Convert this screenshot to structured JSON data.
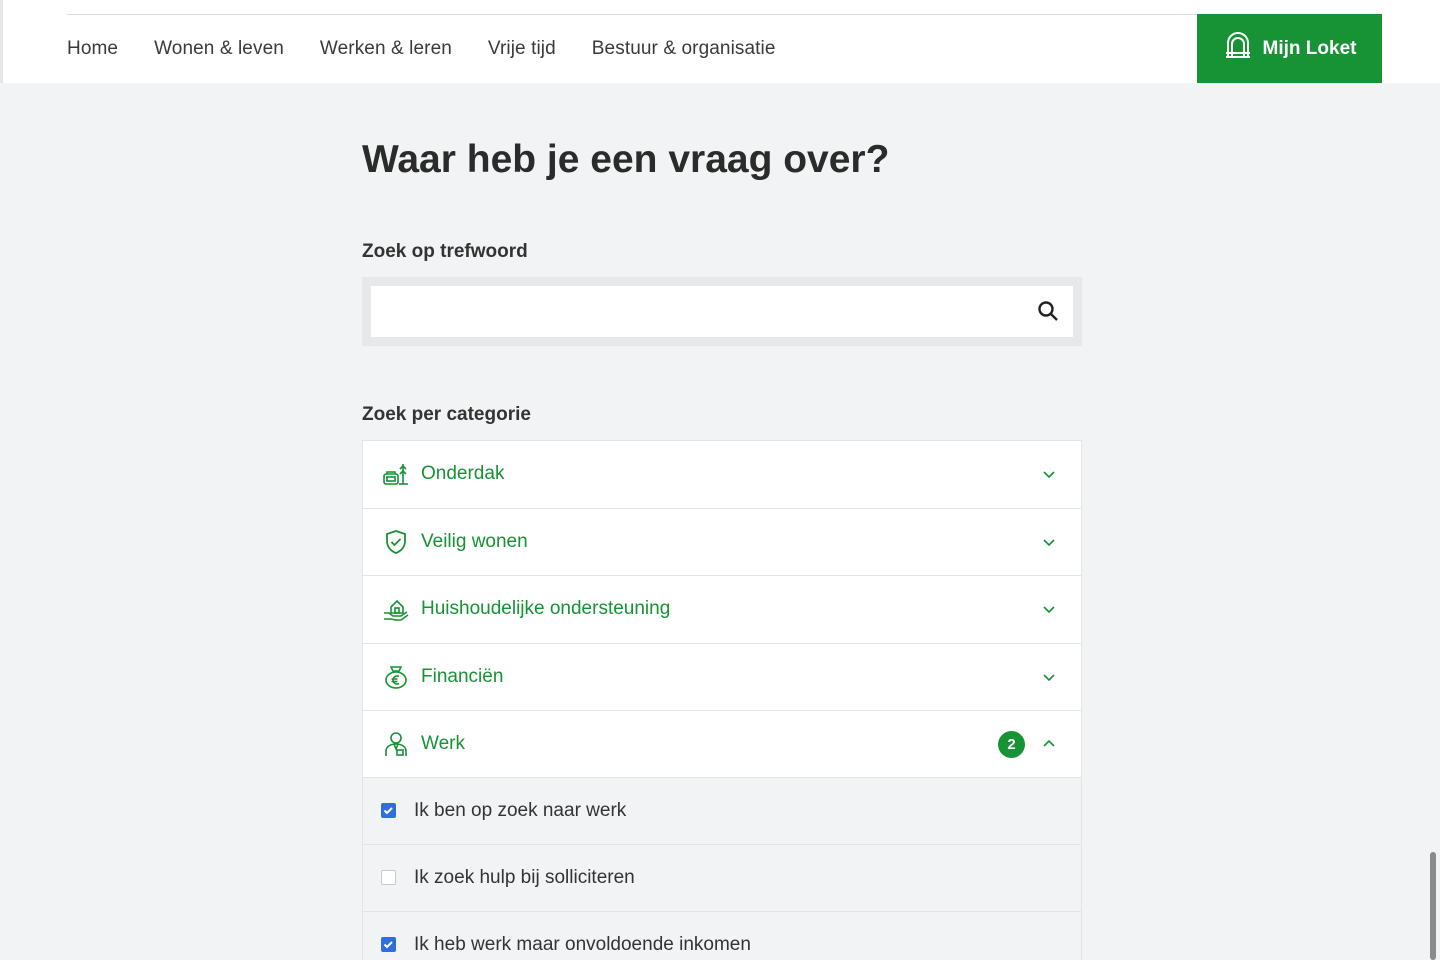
{
  "nav": {
    "links": [
      "Home",
      "Wonen & leven",
      "Werken & leren",
      "Vrije tijd",
      "Bestuur & organisatie"
    ],
    "loket_label": "Mijn Loket"
  },
  "main": {
    "title": "Waar heb je een vraag over?",
    "search_label": "Zoek op trefwoord",
    "search_value": "",
    "category_label": "Zoek per categorie"
  },
  "categories": [
    {
      "label": "Onderdak",
      "icon": "house-tree-icon",
      "expanded": false
    },
    {
      "label": "Veilig wonen",
      "icon": "shield-check-icon",
      "expanded": false
    },
    {
      "label": "Huishoudelijke ondersteuning",
      "icon": "helping-hand-home-icon",
      "expanded": false
    },
    {
      "label": "Financiën",
      "icon": "money-bag-euro-icon",
      "expanded": false
    },
    {
      "label": "Werk",
      "icon": "worker-icon",
      "expanded": true,
      "badge": "2"
    }
  ],
  "werk_options": [
    {
      "label": "Ik ben op zoek naar werk",
      "checked": true
    },
    {
      "label": "Ik zoek hulp bij solliciteren",
      "checked": false
    },
    {
      "label": "Ik heb werk maar onvoldoende inkomen",
      "checked": true
    }
  ],
  "colors": {
    "accent": "#179234",
    "checkbox": "#2f6fdc",
    "background": "#f2f3f5"
  }
}
